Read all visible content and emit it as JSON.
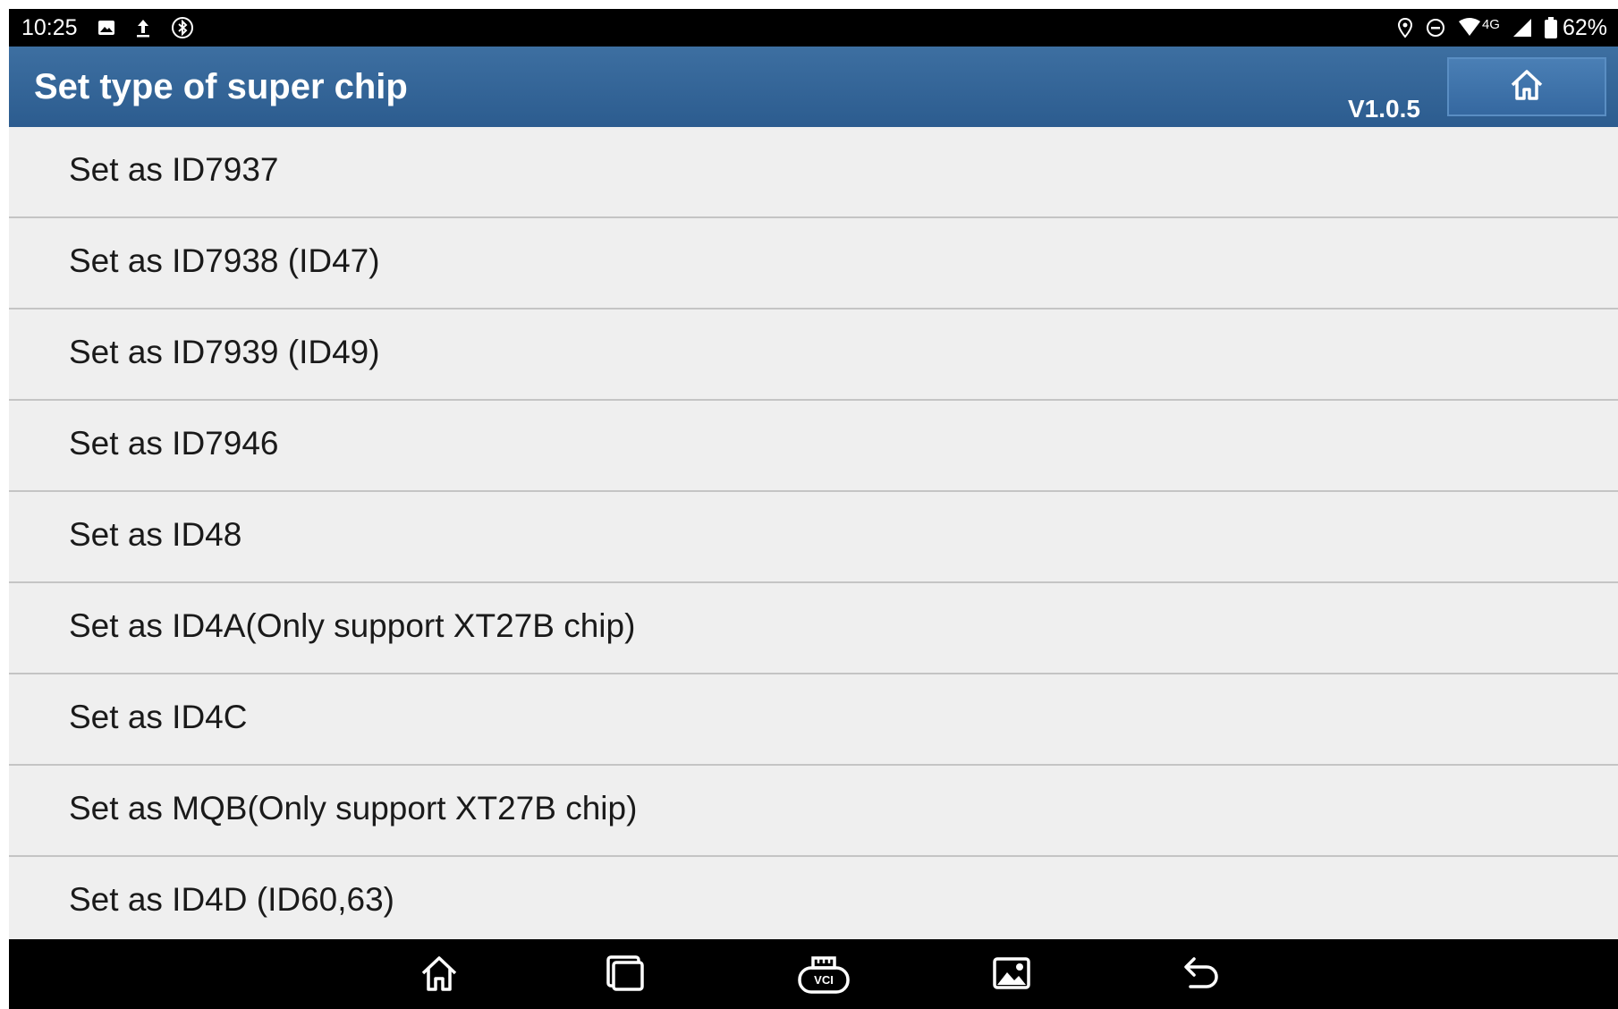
{
  "status_bar": {
    "time": "10:25",
    "network": "4G",
    "battery": "62%",
    "left_icons": [
      "gallery-icon",
      "upload-icon",
      "bluetooth-icon"
    ],
    "right_icons": [
      "location-icon",
      "do-not-disturb-icon",
      "wifi-icon",
      "signal-icon",
      "battery-icon"
    ]
  },
  "header": {
    "title": "Set type of super chip",
    "version": "V1.0.5",
    "home_icon": "home-icon"
  },
  "chip_options": [
    "Set as ID7937",
    "Set as ID7938 (ID47)",
    "Set as ID7939 (ID49)",
    "Set as ID7946",
    "Set as ID48",
    "Set as ID4A(Only support XT27B chip)",
    "Set as ID4C",
    "Set as MQB(Only support XT27B chip)",
    "Set as ID4D (ID60,63)"
  ],
  "nav_bar": {
    "icons": [
      "home-icon",
      "recent-apps-icon",
      "vci-icon",
      "screenshot-icon",
      "back-icon"
    ],
    "vci_label": "VCI"
  },
  "colors": {
    "header": "#2f5f92",
    "list_background": "#efefef",
    "divider": "#c4c4c4",
    "bars": "#000000"
  }
}
